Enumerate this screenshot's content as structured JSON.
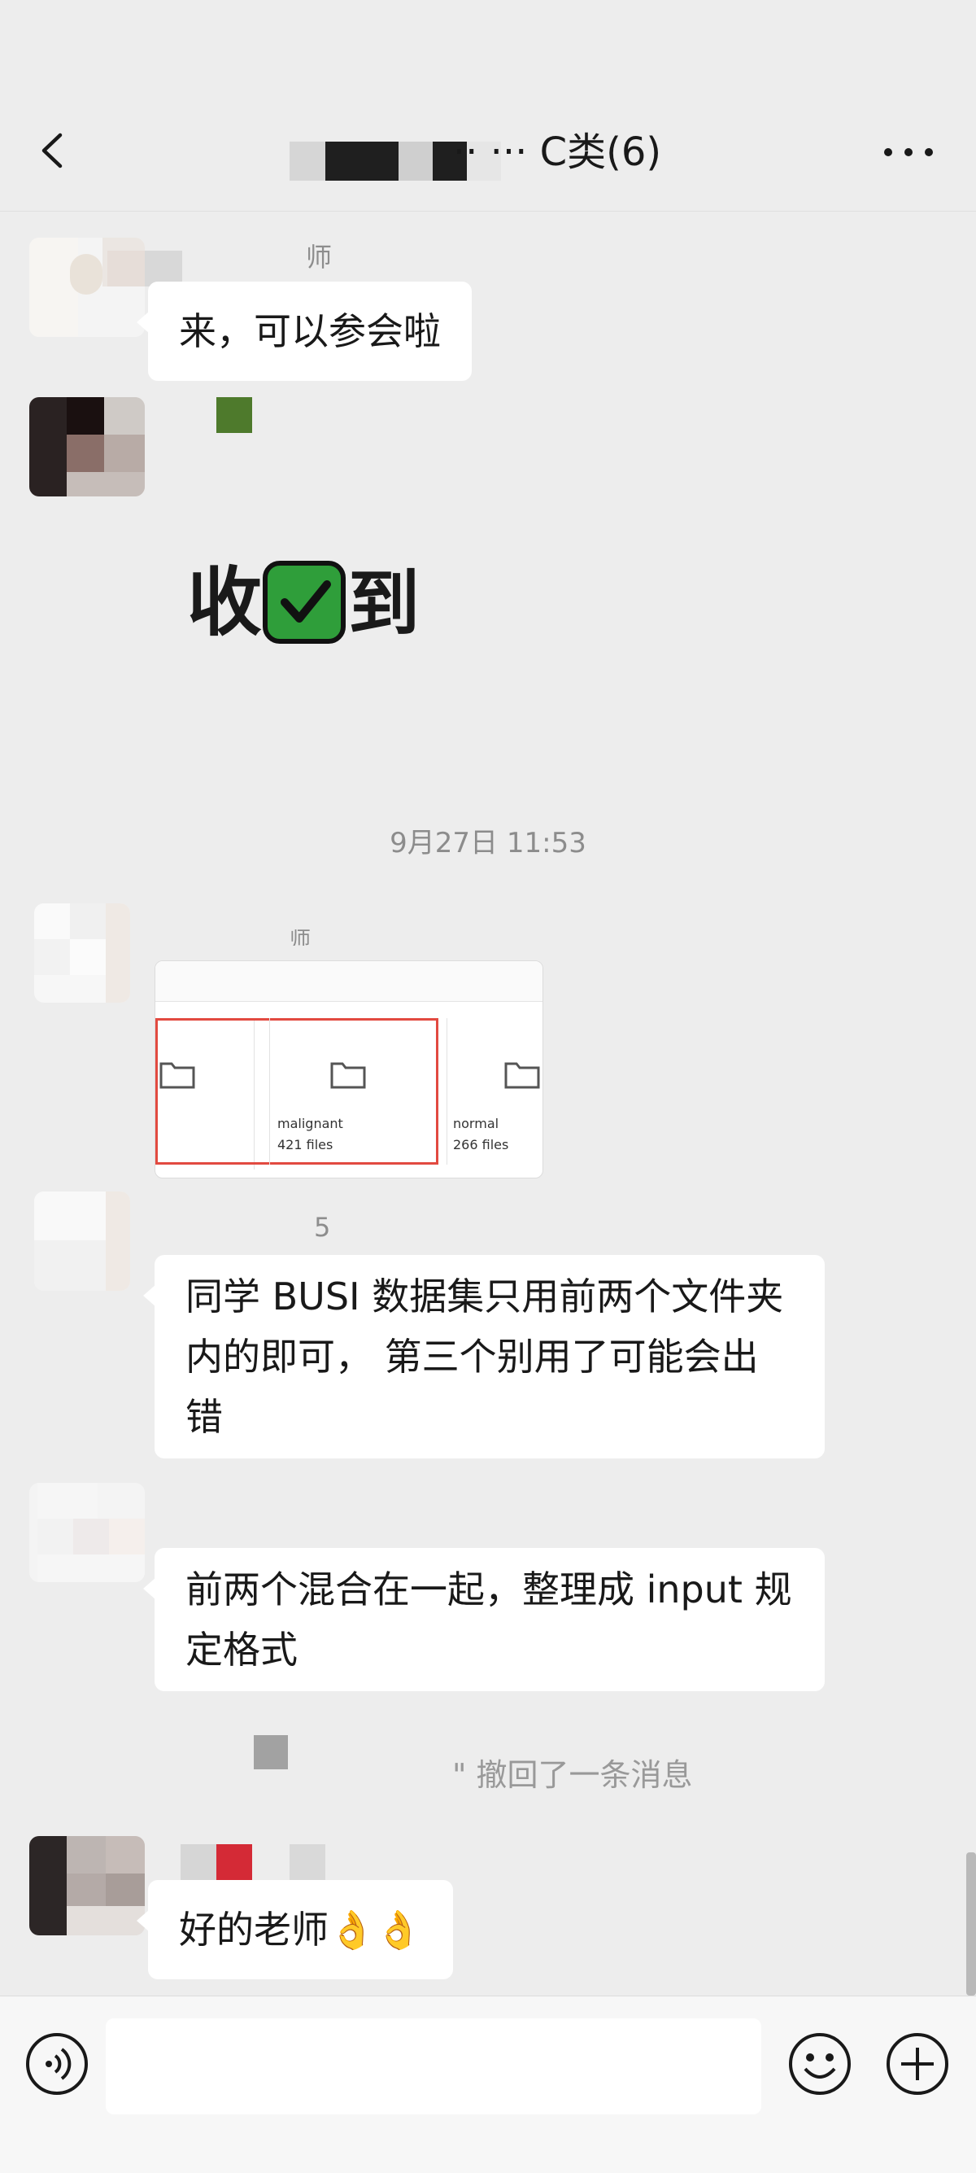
{
  "header": {
    "title": "·· ··· C类(6)",
    "back_icon": "chevron-left-icon",
    "more_icon": "more-dots-icon"
  },
  "messages": [
    {
      "sender_name": "师",
      "text": "来，可以参会啦"
    },
    {
      "sticker_text": "收☑到"
    },
    {
      "timestamp": "9月27日 11:53"
    },
    {
      "sender_name": "师",
      "image_folders": [
        {
          "name": "",
          "count": ""
        },
        {
          "name": "malignant",
          "count": "421 files"
        },
        {
          "name": "normal",
          "count": "266 files"
        }
      ]
    },
    {
      "sender_name": "5",
      "text": "同学 BUSI 数据集只用前两个文件夹内的即可，  第三个别用了可能会出错"
    },
    {
      "text": "前两个混合在一起，整理成 input 规定格式"
    },
    {
      "system_text": "\" 撤回了一条消息"
    },
    {
      "text": "好的老师👌👌"
    }
  ],
  "composer": {
    "voice_icon": "voice-icon",
    "emoji_icon": "emoji-icon",
    "plus_icon": "plus-icon",
    "placeholder": ""
  },
  "colors": {
    "background": "#ededed",
    "bubble": "#ffffff",
    "sticker_green": "#2f9e3a",
    "time_gray": "#8c8c8c"
  }
}
